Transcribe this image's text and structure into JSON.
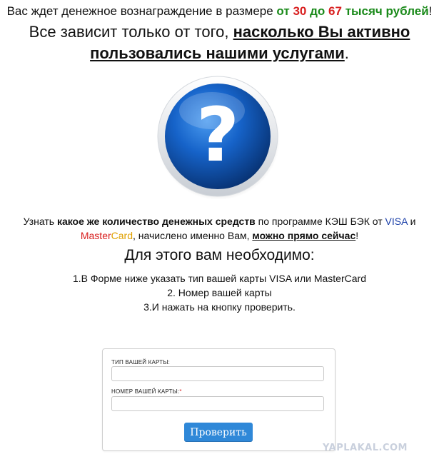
{
  "header": {
    "reward_prefix": "Вас ждет денежное вознаграждение  в размере",
    "reward_from": "от",
    "reward_min": "30",
    "reward_to": "до",
    "reward_max": "67",
    "reward_unit": "тысяч рублей",
    "reward_end": "!",
    "headline_start": "Все зависит только от того,",
    "headline_emphasis": "насколько Вы активно пользовались нашими услугами",
    "headline_end": "."
  },
  "illustration": {
    "icon": "question-mark-icon",
    "glyph": "?"
  },
  "info": {
    "part1": "Узнать",
    "part2": "какое же количество денежных средств",
    "part3": "по программе КЭШ БЭК от",
    "visa": "VISA",
    "part4": "и",
    "master": "Master",
    "card": "Card",
    "part5": ", начислено именно Вам,",
    "part6": "можно прямо сейчас",
    "part7": "!"
  },
  "need_title": "Для этого вам необходимо:",
  "steps": [
    "1.В Форме ниже указать тип вашей карты VISA или MasterCard",
    "2. Номер вашей карты",
    "3.И нажать на кнопку проверить."
  ],
  "form": {
    "card_type_label": "ТИП ВАШЕЙ КАРТЫ:",
    "card_type_value": "",
    "card_number_label": "НОМЕР ВАШЕЙ КАРТЫ:",
    "required_mark": "*",
    "card_number_value": "",
    "submit_label": "Проверить"
  },
  "watermark": "YAPLAKAL.COM",
  "colors": {
    "accent_blue": "#2f88d8",
    "green": "#1a8a1a",
    "red": "#d81e1e",
    "visa_blue": "#1a3fa8",
    "card_orange": "#e0a000"
  }
}
